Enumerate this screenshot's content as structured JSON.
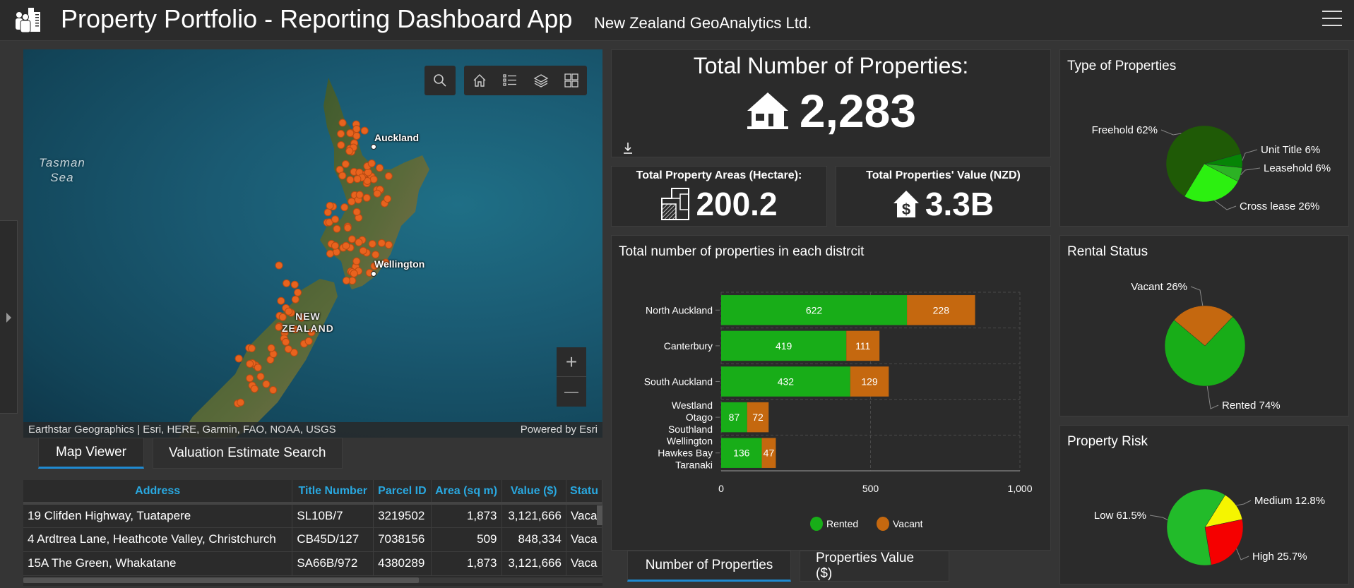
{
  "header": {
    "title": "Property Portfolio - Reporting Dashboard App",
    "subtitle": "New Zealand GeoAnalytics Ltd.",
    "logo_icon": "people-building-icon",
    "menu_icon": "hamburger-menu-icon"
  },
  "map": {
    "labels": {
      "sea": [
        "Tasman",
        "Sea"
      ],
      "country": [
        "NEW",
        "ZEALAND"
      ],
      "cities": [
        "Auckland",
        "Wellington"
      ]
    },
    "tools": [
      "search-icon",
      "home-icon",
      "legend-list-icon",
      "layers-icon",
      "basemap-gallery-icon"
    ],
    "zoom": {
      "in": "+",
      "out": "—"
    },
    "attribution": "Earthstar Geographics | Esri, HERE, Garmin, FAO, NOAA, USGS",
    "powered_by": "Powered by Esri",
    "marker_color": "#e8631e"
  },
  "left_tabs": [
    {
      "label": "Map Viewer",
      "active": true
    },
    {
      "label": "Valuation Estimate Search",
      "active": false
    }
  ],
  "table": {
    "columns": [
      "Address",
      "Title Number",
      "Parcel ID",
      "Area (sq m)",
      "Value ($)",
      "Statu"
    ],
    "rows": [
      [
        "19 Clifden Highway, Tuatapere",
        "SL10B/7",
        "3219502",
        "1,873",
        "3,121,666",
        "Vaca"
      ],
      [
        "4 Ardtrea Lane, Heathcote Valley, Christchurch",
        "CB45D/127",
        "7038156",
        "509",
        "848,334",
        "Vaca"
      ],
      [
        "15A The Green, Whakatane",
        "SA66B/972",
        "4380289",
        "1,873",
        "3,121,666",
        "Vaca"
      ]
    ]
  },
  "kpis": {
    "total_properties": {
      "title": "Total Number of Properties:",
      "value": "2,283",
      "icon": "house-icon"
    },
    "total_area": {
      "title": "Total Property Areas (Hectare):",
      "value": "200.2",
      "icon": "land-parcel-icon"
    },
    "total_value": {
      "title": "Total Properties' Value (NZD)",
      "value": "3.3B",
      "icon": "house-dollar-icon"
    }
  },
  "middle_tabs": [
    {
      "label": "Number of Properties",
      "active": true
    },
    {
      "label": "Properties Value ($)",
      "active": false
    }
  ],
  "colors": {
    "rented": "#18ad18",
    "vacant": "#c5680f",
    "accent": "#1f8ad1",
    "header_text": "#29a8e0"
  },
  "chart_data": [
    {
      "type": "bar",
      "orientation": "horizontal",
      "stacked": true,
      "title": "Total number of properties in each distrcit",
      "categories": [
        "North Auckland",
        "Canterbury",
        "South Auckland",
        "Westland\nOtago\nSouthland",
        "Wellington\nHawkes Bay\nTaranaki"
      ],
      "series": [
        {
          "name": "Rented",
          "color": "#18ad18",
          "values": [
            622,
            419,
            432,
            87,
            136
          ]
        },
        {
          "name": "Vacant",
          "color": "#c5680f",
          "values": [
            228,
            111,
            129,
            72,
            47
          ]
        }
      ],
      "xlim": [
        0,
        1000
      ],
      "xticks": [
        "0",
        "500",
        "1,000"
      ],
      "grid": true,
      "legend": "bottom"
    },
    {
      "type": "pie",
      "title": "Type of Properties",
      "slices": [
        {
          "label": "Freehold",
          "value": 62,
          "text": "Freehold 62%",
          "color": "#1f5a06"
        },
        {
          "label": "Unit Title",
          "value": 6,
          "text": "Unit Title 6%",
          "color": "#068406"
        },
        {
          "label": "Leasehold",
          "value": 6,
          "text": "Leasehold 6%",
          "color": "#2cb224"
        },
        {
          "label": "Cross lease",
          "value": 26,
          "text": "Cross lease 26%",
          "color": "#2cf010"
        }
      ]
    },
    {
      "type": "pie",
      "title": "Rental Status",
      "slices": [
        {
          "label": "Vacant",
          "value": 26,
          "text": "Vacant 26%",
          "color": "#c5680f"
        },
        {
          "label": "Rented",
          "value": 74,
          "text": "Rented 74%",
          "color": "#18ad18"
        }
      ]
    },
    {
      "type": "pie",
      "title": "Property Risk",
      "slices": [
        {
          "label": "Medium",
          "value": 12.8,
          "text": "Medium 12.8%",
          "color": "#f5f500"
        },
        {
          "label": "High",
          "value": 25.7,
          "text": "High 25.7%",
          "color": "#f50000"
        },
        {
          "label": "Low",
          "value": 61.5,
          "text": "Low 61.5%",
          "color": "#22bb2a"
        }
      ]
    }
  ]
}
